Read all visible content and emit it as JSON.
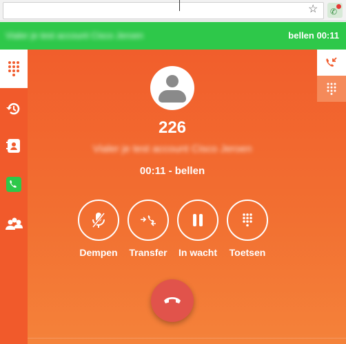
{
  "browser": {
    "star_icon": "star-icon",
    "extension_icon": "phone-extension-icon"
  },
  "topbar": {
    "account_name": "Vialer je test account Cisco Jeroen",
    "call_status": "bellen 00:11"
  },
  "sidebar": {
    "items": [
      {
        "icon": "dialpad-icon",
        "active": true
      },
      {
        "icon": "recent-calls-icon",
        "active": false
      },
      {
        "icon": "contacts-icon",
        "active": false
      },
      {
        "icon": "phone-icon",
        "active": false
      },
      {
        "icon": "colleagues-icon",
        "active": false
      }
    ]
  },
  "right_tabs": [
    {
      "icon": "incoming-call-icon",
      "active": true
    },
    {
      "icon": "dialpad-icon",
      "active": false
    }
  ],
  "call": {
    "number": "226",
    "contact_name": "Vialer je test account Cisco Jeroen",
    "timer_status": "00:11 - bellen"
  },
  "controls": {
    "mute": "Dempen",
    "transfer": "Transfer",
    "hold": "In wacht",
    "keypad": "Toetsen"
  },
  "hangup": {
    "icon": "hang-up-icon"
  },
  "colors": {
    "green": "#2ec84a",
    "orange": "#f15a2b",
    "red": "#e1534b"
  }
}
